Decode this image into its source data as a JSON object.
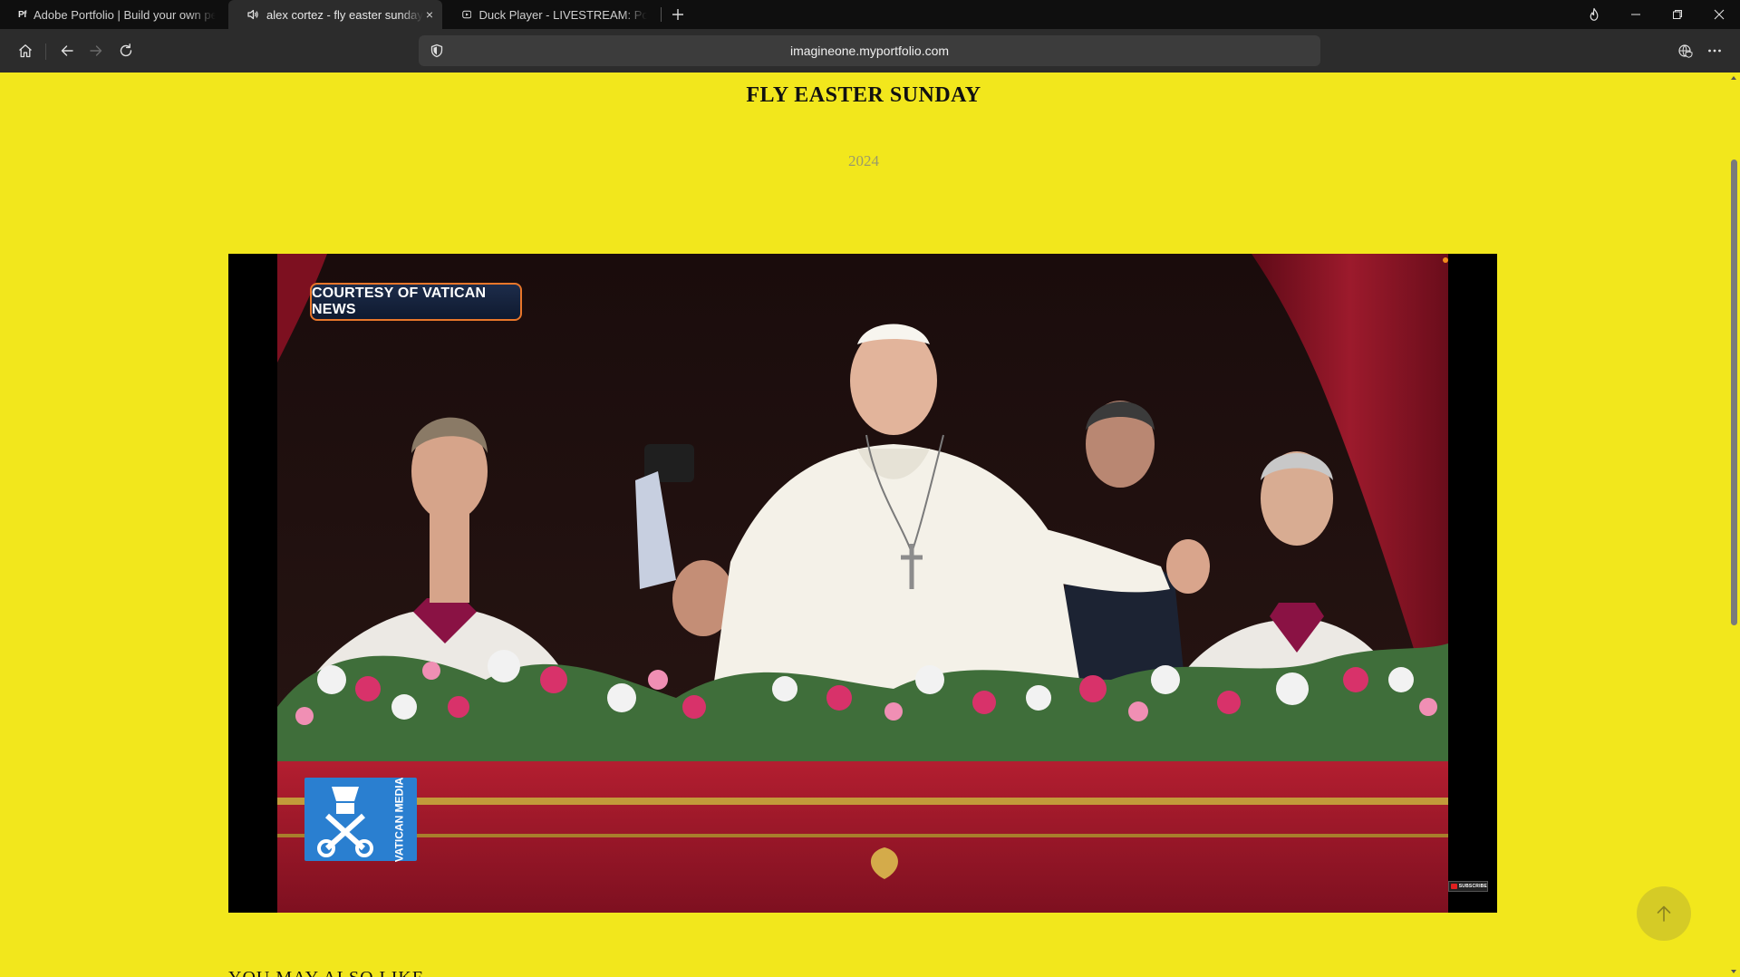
{
  "browser": {
    "tabs": [
      {
        "label": "Adobe Portfolio | Build your own personal website",
        "icon": "adobe-portfolio-icon",
        "icon_text": "Pf",
        "active": false
      },
      {
        "label": "alex cortez - fly easter sunday",
        "icon": "speaker-icon",
        "active": true,
        "close_label": "×"
      },
      {
        "label": "Duck Player - LIVESTREAM: Pope Francis",
        "icon": "duck-player-icon",
        "active": false
      }
    ],
    "new_tab_label": "+",
    "url": "imagineone.myportfolio.com"
  },
  "page": {
    "title": "FLY EASTER SUNDAY",
    "year": "2024",
    "video": {
      "courtesy_label": "COURTESY OF VATICAN NEWS",
      "logo_text": "VATICAN MEDIA",
      "subscribe_label": "SUBSCRIBE"
    },
    "also_like": "YOU MAY ALSO LIKE"
  },
  "colors": {
    "page_background": "#f2e71c",
    "title_text": "#111111",
    "year_text": "#9a9a6a",
    "courtesy_border": "#e8762a",
    "vatican_media_blue": "#2a7fd0"
  }
}
